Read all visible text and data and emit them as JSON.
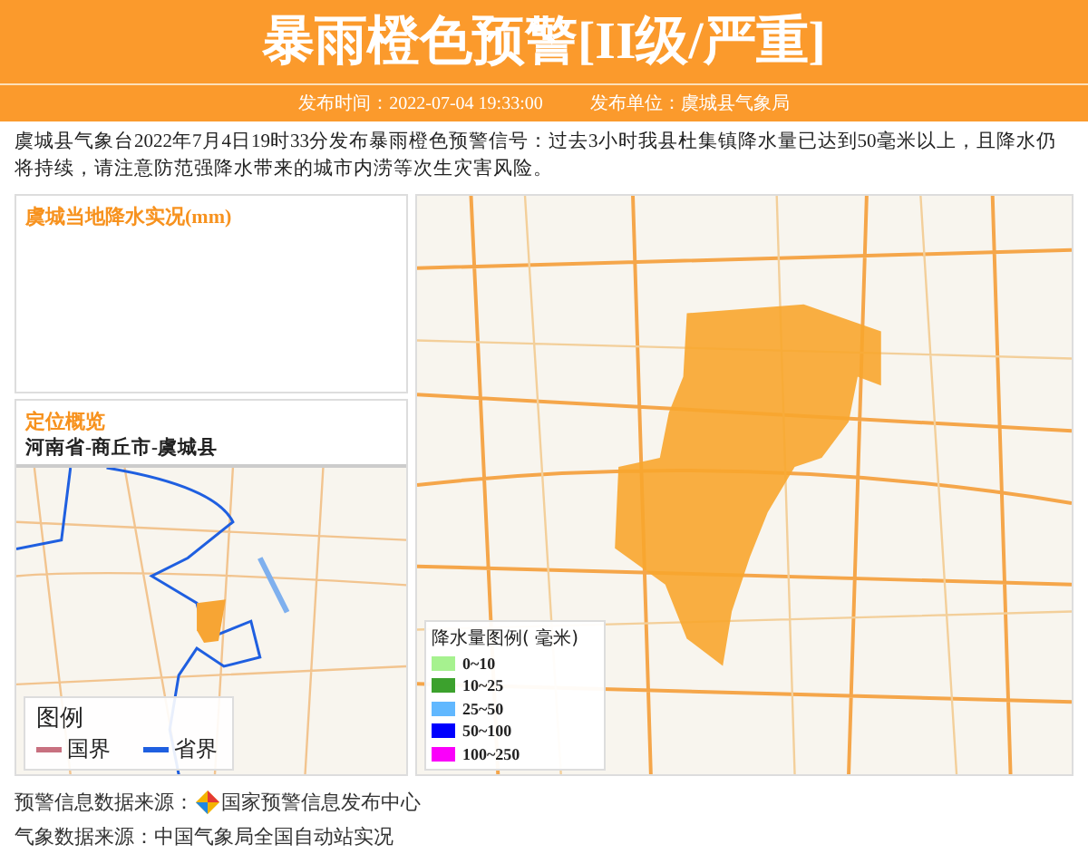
{
  "header": {
    "title": "暴雨橙色预警",
    "level": "[II级/严重]",
    "publish_time": "发布时间：2022-07-04 19:33:00",
    "publisher": "发布单位：虞城县气象局"
  },
  "description": "虞城县气象台2022年7月4日19时33分发布暴雨橙色预警信号：过去3小时我县杜集镇降水量已达到50毫米以上，且降水仍将持续，请注意防范强降水带来的城市内涝等次生灾害风险。",
  "rainfall_panel": {
    "title": "虞城当地降水实况(mm)"
  },
  "location_panel": {
    "title": "定位概览",
    "path": "河南省-商丘市-虞城县",
    "legend": {
      "title": "图例",
      "items": [
        {
          "label": "国界",
          "color": "#c8707f"
        },
        {
          "label": "省界",
          "color": "#1f5fe0"
        }
      ]
    }
  },
  "rain_legend": {
    "title": "降水量图例( 毫米)",
    "items": [
      {
        "label": "0~10",
        "color": "#a6f28f"
      },
      {
        "label": "10~25",
        "color": "#3ca12d"
      },
      {
        "label": "25~50",
        "color": "#61b8ff"
      },
      {
        "label": "50~100",
        "color": "#0000fe"
      },
      {
        "label": "100~250",
        "color": "#fa00fa"
      }
    ]
  },
  "footer": {
    "warning_source_label": "预警信息数据来源：",
    "warning_source": "国家预警信息发布中心",
    "weather_source": "气象数据来源：中国气象局全国自动站实况"
  }
}
